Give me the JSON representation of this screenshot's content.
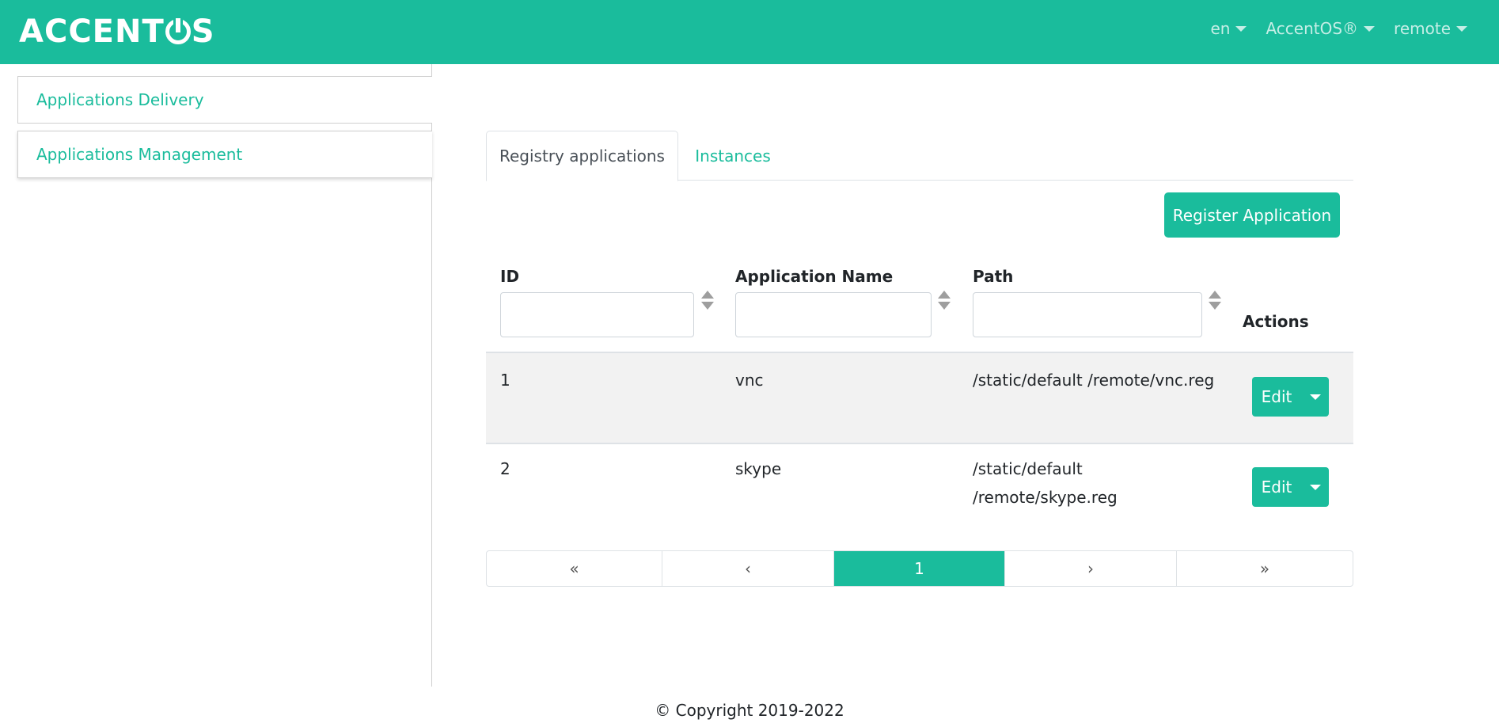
{
  "navbar": {
    "logo_left": "ACCENT",
    "logo_right": "S",
    "menus": [
      "en",
      "AccentOS®",
      "remote"
    ]
  },
  "sidebar": {
    "items": [
      {
        "label": "Applications Delivery"
      },
      {
        "label": "Applications Management"
      }
    ]
  },
  "tabs": [
    {
      "label": "Registry applications",
      "active": true
    },
    {
      "label": "Instances",
      "active": false
    }
  ],
  "toolbar": {
    "register_label": "Register Application"
  },
  "table": {
    "columns": [
      "ID",
      "Application Name",
      "Path",
      "Actions"
    ],
    "rows": [
      {
        "id": "1",
        "name": "vnc",
        "path_line1": "/static/default /remote/vnc.reg",
        "path_line2": "",
        "action": "Edit"
      },
      {
        "id": "2",
        "name": "skype",
        "path_line1": "/static/default",
        "path_line2": "/remote/skype.reg",
        "action": "Edit"
      }
    ]
  },
  "pagination": {
    "items": [
      "«",
      "‹",
      "1",
      "›",
      "»"
    ],
    "current": "1"
  },
  "footer": {
    "text": "© Copyright 2019-2022"
  },
  "colors": {
    "accent": "#1abc9c"
  }
}
